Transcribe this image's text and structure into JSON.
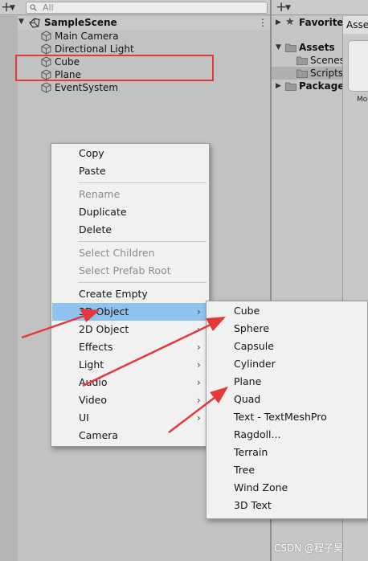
{
  "hierarchy": {
    "search_placeholder": "All",
    "scene_name": "SampleScene",
    "items": [
      {
        "label": "Main Camera"
      },
      {
        "label": "Directional Light"
      },
      {
        "label": "Cube"
      },
      {
        "label": "Plane"
      },
      {
        "label": "EventSystem"
      }
    ]
  },
  "project": {
    "tree": [
      {
        "label": "Favorites"
      },
      {
        "label": "Assets"
      },
      {
        "label": "Scenes"
      },
      {
        "label": "Scripts"
      },
      {
        "label": "Packages"
      }
    ],
    "assets_tab": "Assets",
    "asset_caption": "Mo"
  },
  "context_menu": {
    "items": [
      {
        "label": "Copy",
        "enabled": true
      },
      {
        "label": "Paste",
        "enabled": true
      },
      {
        "label": "Rename",
        "enabled": false
      },
      {
        "label": "Duplicate",
        "enabled": true
      },
      {
        "label": "Delete",
        "enabled": true
      },
      {
        "label": "Select Children",
        "enabled": false
      },
      {
        "label": "Select Prefab Root",
        "enabled": false
      },
      {
        "label": "Create Empty",
        "enabled": true
      },
      {
        "label": "3D Object",
        "enabled": true,
        "submenu": true,
        "highlighted": true
      },
      {
        "label": "2D Object",
        "enabled": true,
        "submenu": true
      },
      {
        "label": "Effects",
        "enabled": true,
        "submenu": true
      },
      {
        "label": "Light",
        "enabled": true,
        "submenu": true
      },
      {
        "label": "Audio",
        "enabled": true,
        "submenu": true
      },
      {
        "label": "Video",
        "enabled": true,
        "submenu": true
      },
      {
        "label": "UI",
        "enabled": true,
        "submenu": true
      },
      {
        "label": "Camera",
        "enabled": true
      }
    ]
  },
  "submenu_3d": {
    "items": [
      {
        "label": "Cube"
      },
      {
        "label": "Sphere"
      },
      {
        "label": "Capsule"
      },
      {
        "label": "Cylinder"
      },
      {
        "label": "Plane"
      },
      {
        "label": "Quad"
      },
      {
        "label": "Text - TextMeshPro"
      },
      {
        "label": "Ragdoll..."
      },
      {
        "label": "Terrain"
      },
      {
        "label": "Tree"
      },
      {
        "label": "Wind Zone"
      },
      {
        "label": "3D Text"
      }
    ]
  },
  "colors": {
    "highlight_row": "#8fc2ef",
    "annotation": "#e5383b"
  },
  "watermark": "CSDN @程子昊",
  "icons": {
    "add": "plus-icon",
    "search": "search-icon",
    "scene": "unity-scene-icon",
    "gameobject": "cube-icon",
    "favorites": "star-icon",
    "folder": "folder-icon",
    "submenu": "chevron-right-icon"
  }
}
